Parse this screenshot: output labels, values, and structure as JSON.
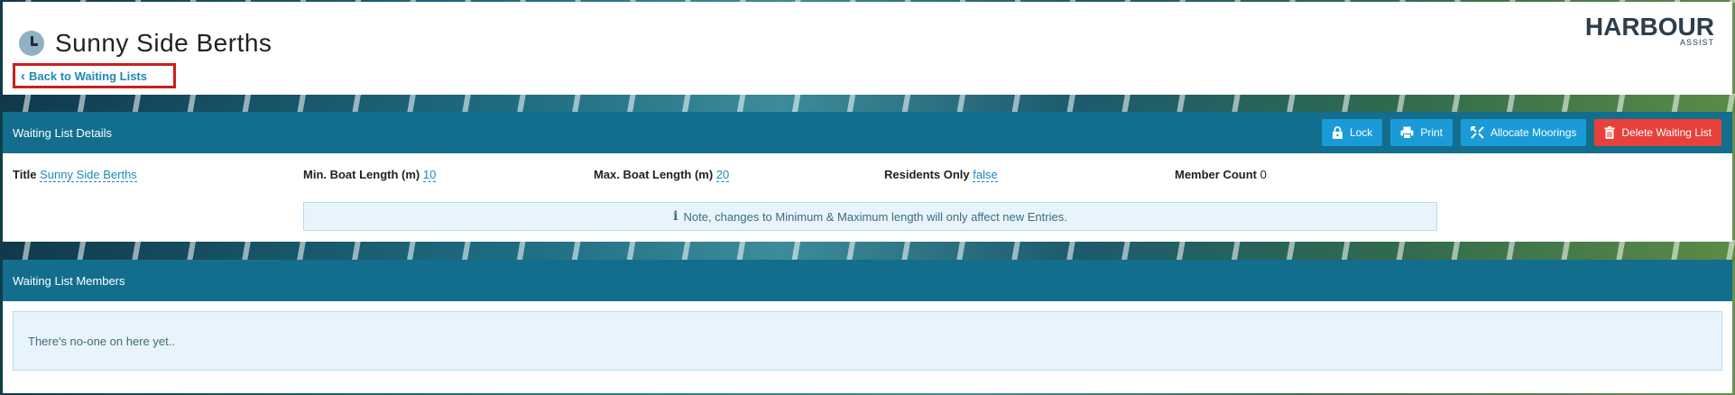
{
  "header": {
    "title": "Sunny Side Berths",
    "back_label": "Back to Waiting Lists",
    "logo_main": "HARBOUR",
    "logo_sub": "ASSIST"
  },
  "details": {
    "heading": "Waiting List Details",
    "buttons": {
      "lock": "Lock",
      "print": "Print",
      "allocate": "Allocate Moorings",
      "delete": "Delete Waiting List"
    },
    "fields": {
      "title_label": "Title",
      "title_value": "Sunny Side Berths",
      "min_label": "Min. Boat Length (m)",
      "min_value": "10",
      "max_label": "Max. Boat Length (m)",
      "max_value": "20",
      "residents_label": "Residents Only",
      "residents_value": "false",
      "count_label": "Member Count",
      "count_value": "0"
    },
    "note": "Note, changes to Minimum & Maximum length will only affect new Entries."
  },
  "members": {
    "heading": "Waiting List Members",
    "empty_message": "There's no-one on here yet.."
  },
  "colors": {
    "panel_header": "#136e8e",
    "button_blue": "#1a9bd7",
    "button_red": "#e8403b",
    "link": "#1a8bb5",
    "highlight_border": "#cc1f1f"
  }
}
